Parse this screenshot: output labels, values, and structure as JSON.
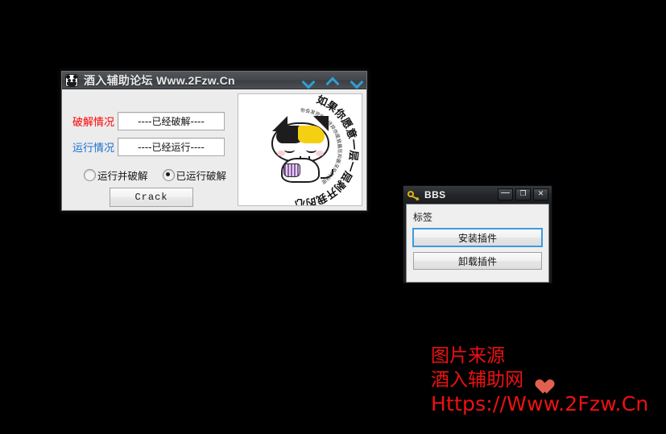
{
  "main_window": {
    "title": "酒入辅助论坛 Www.2Fzw.Cn",
    "icon": "panda-icon",
    "title_buttons": [
      {
        "name": "minimize-chevron",
        "glyph": "chevron-down"
      },
      {
        "name": "maximize-chevron",
        "glyph": "chevron-up"
      },
      {
        "name": "close-chevron",
        "glyph": "chevron-down"
      }
    ],
    "fields": [
      {
        "label": "破解情况",
        "label_color": "#ff0000",
        "value": "----已经破解----"
      },
      {
        "label": "运行情况",
        "label_color": "#1a6fd4",
        "value": "----已经运行----"
      }
    ],
    "radios": [
      {
        "label": "运行并破解",
        "selected": false
      },
      {
        "label": "已运行破解",
        "selected": true
      }
    ],
    "crack_button": "Crack",
    "artwork": {
      "outer_ring_text": "如果你愿意一层一层剥开我的心",
      "inner_ring_text": "你会发现你会讶异你是我最压抑最深处的秘密",
      "description": "circular-text-cat-illustration"
    }
  },
  "bbs_window": {
    "title": "BBS",
    "icon": "key-icon",
    "title_buttons": [
      {
        "name": "minimize-button",
        "glyph": "—"
      },
      {
        "name": "maximize-button",
        "glyph": "❐"
      },
      {
        "name": "close-button",
        "glyph": "✕"
      }
    ],
    "tag_label": "标签",
    "buttons": [
      {
        "label": "安装插件",
        "focused": true
      },
      {
        "label": "卸载插件",
        "focused": false
      }
    ]
  },
  "watermark": {
    "line1": "图片来源",
    "line2": "酒入辅助网",
    "line3": "Https://Www.2Fzw.Cn",
    "color": "#ee1111",
    "heart_color": "#e1604f"
  }
}
